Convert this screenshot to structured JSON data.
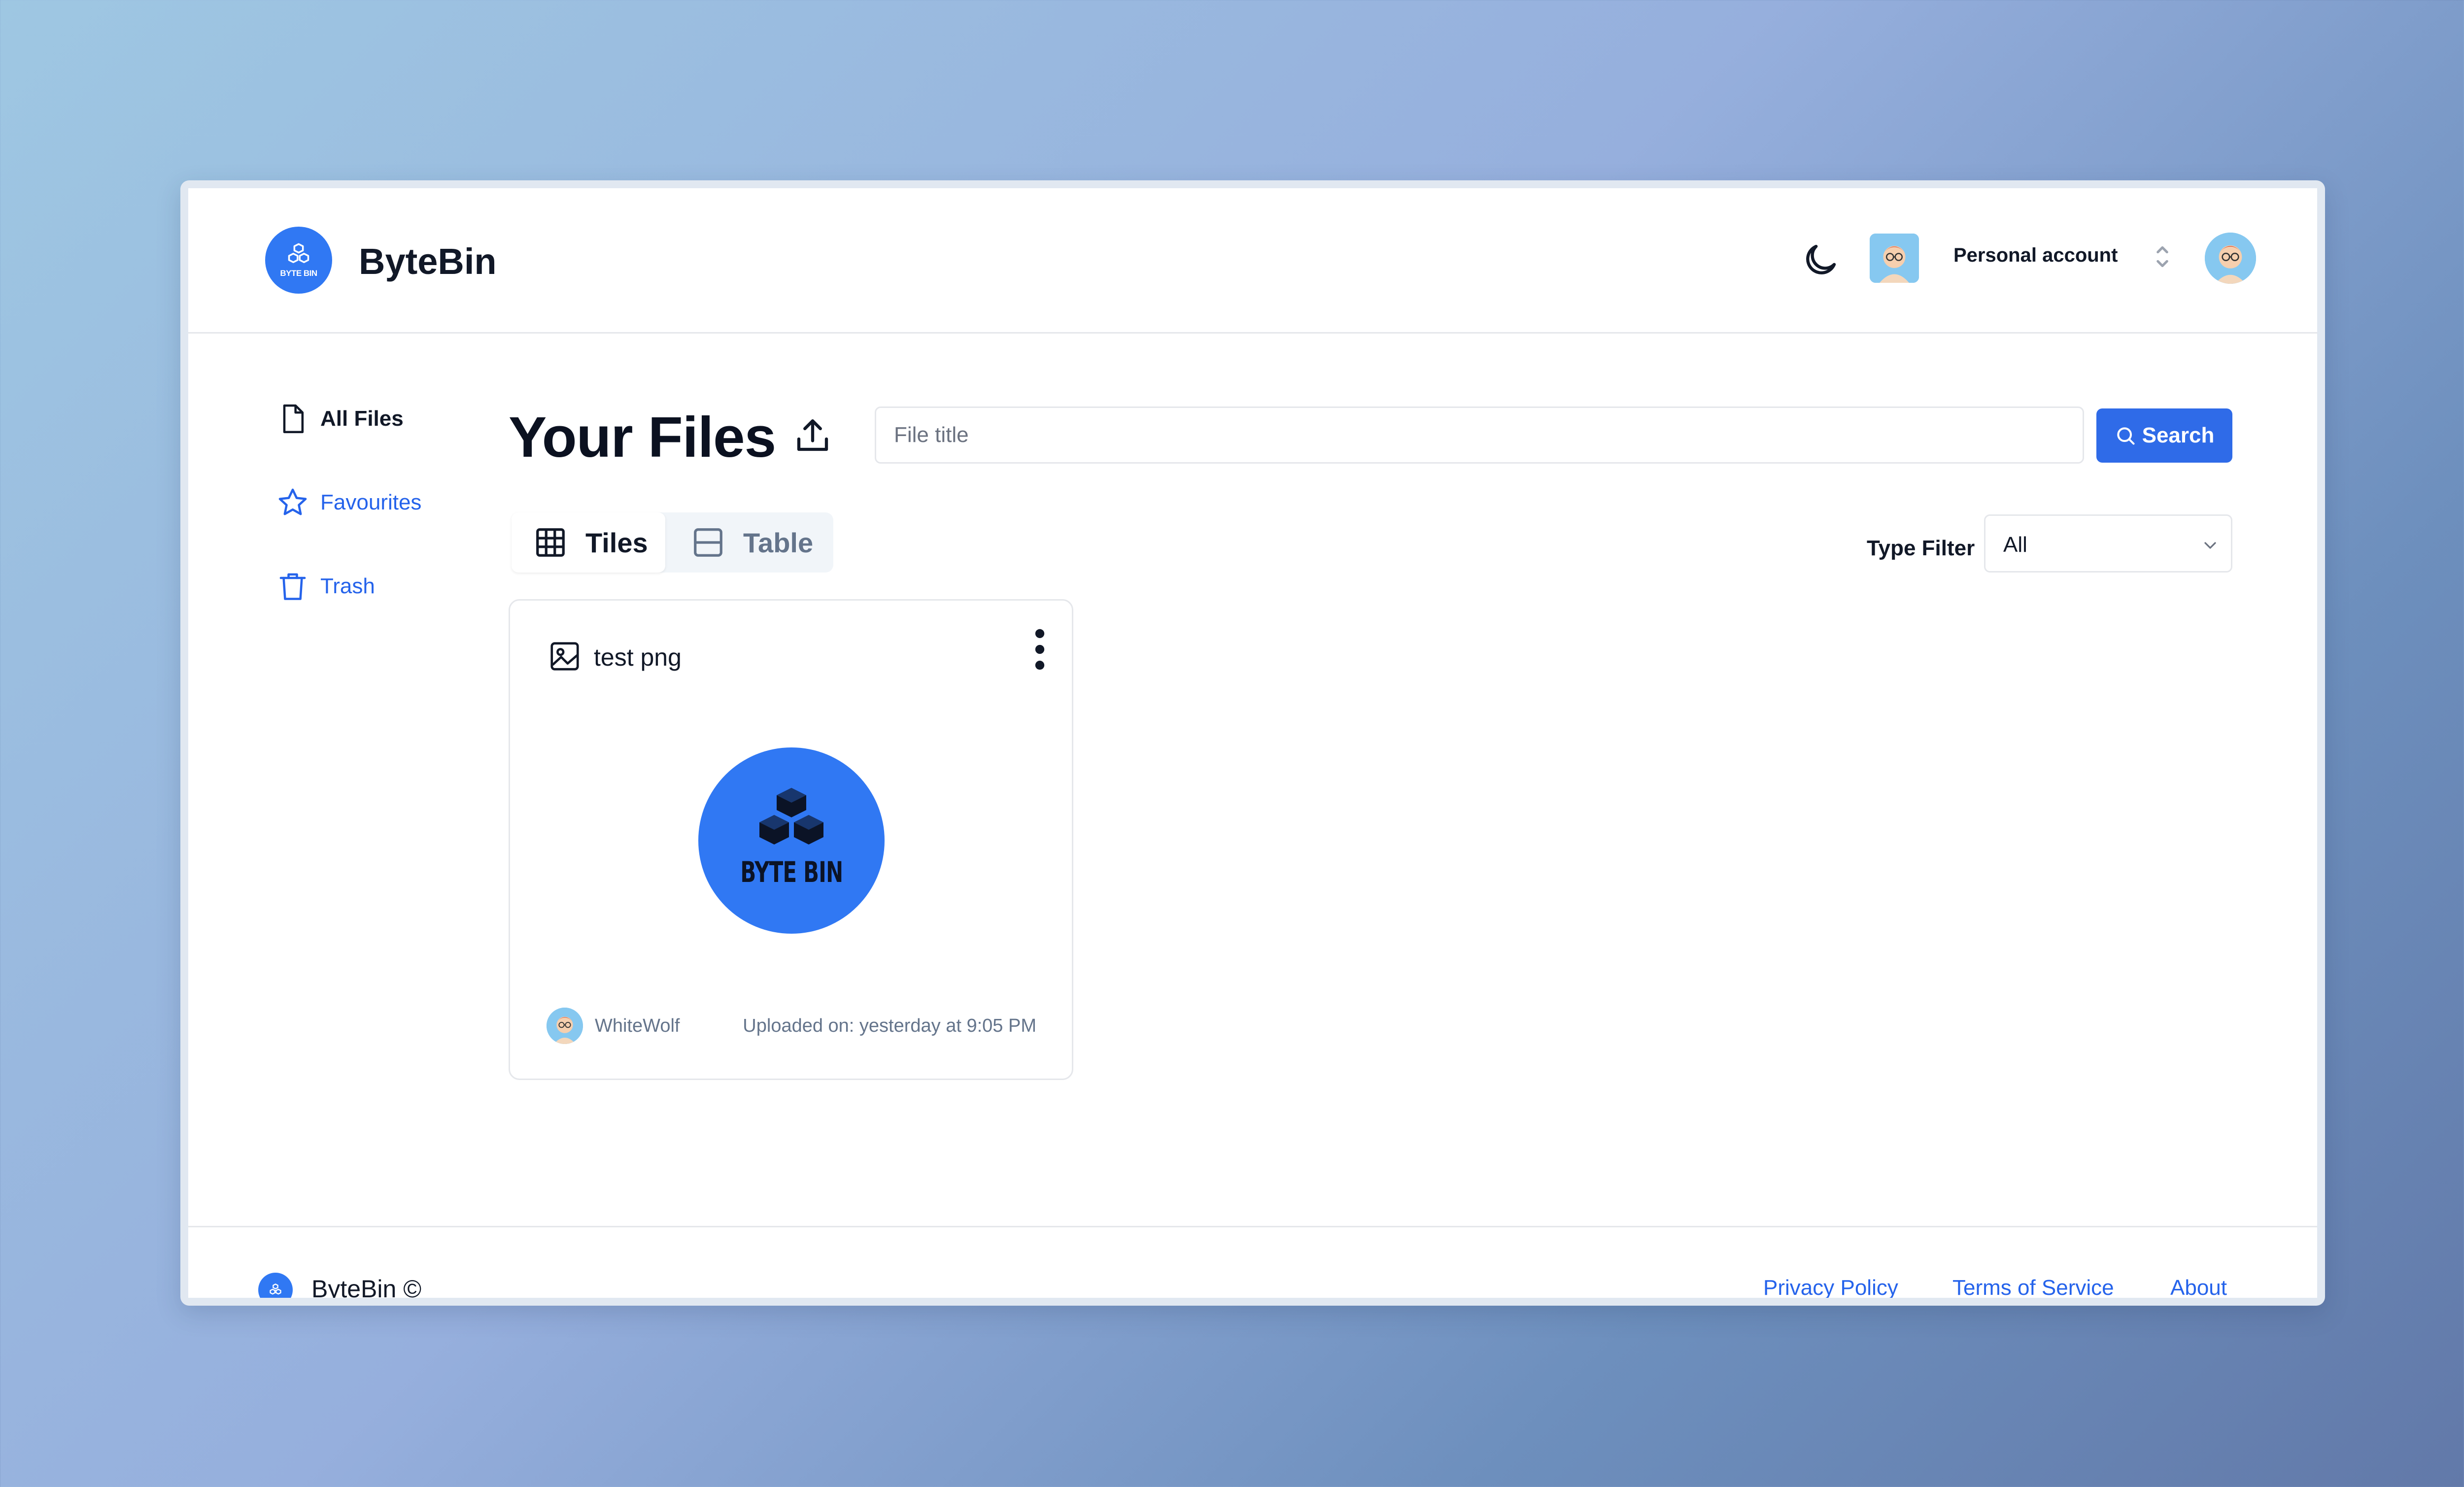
{
  "header": {
    "brand": "ByteBin",
    "logo_text": "BYTE BIN",
    "account_label": "Personal account"
  },
  "sidebar": {
    "items": [
      {
        "label": "All Files",
        "icon": "file-icon",
        "active": true
      },
      {
        "label": "Favourites",
        "icon": "star-icon",
        "active": false
      },
      {
        "label": "Trash",
        "icon": "trash-icon",
        "active": false
      }
    ]
  },
  "main": {
    "title": "Your Files",
    "search": {
      "placeholder": "File title",
      "value": "",
      "button_label": "Search"
    },
    "view_tabs": [
      {
        "label": "Tiles",
        "icon": "grid-icon",
        "selected": true
      },
      {
        "label": "Table",
        "icon": "rows-icon",
        "selected": false
      }
    ],
    "type_filter": {
      "label": "Type Filter",
      "value": "All"
    }
  },
  "files": [
    {
      "title": "test png",
      "type_icon": "image-icon",
      "preview_text": "BYTE BIN",
      "owner": "WhiteWolf",
      "uploaded": "Uploaded on: yesterday at 9:05 PM"
    }
  ],
  "footer": {
    "brand": "ByteBin ©",
    "links": [
      "Privacy Policy",
      "Terms of Service",
      "About"
    ]
  },
  "colors": {
    "primary": "#2f6be8",
    "logo_blue": "#3078f3",
    "link": "#2563eb",
    "text": "#111827",
    "muted": "#64748b",
    "border": "#e5e7eb"
  }
}
